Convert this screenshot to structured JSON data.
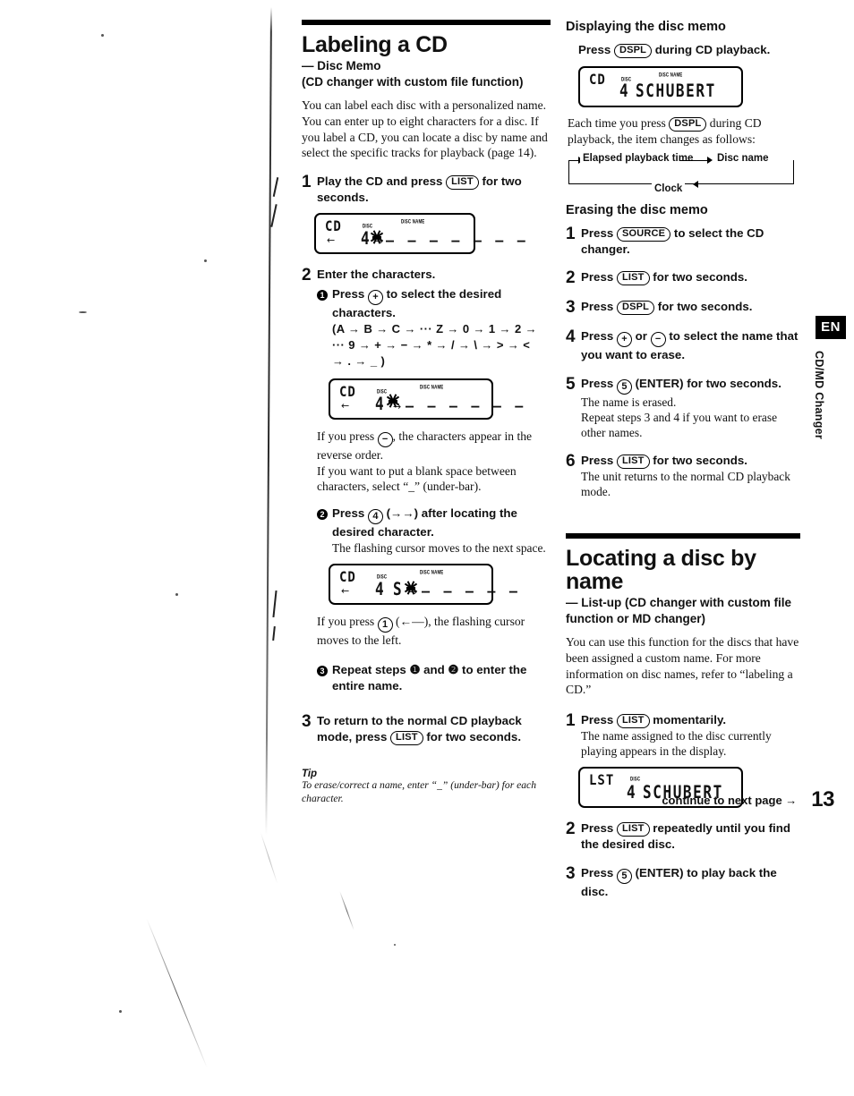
{
  "page": {
    "number": "13",
    "continue_note": "continue to next page →",
    "side_tab_language": "EN",
    "side_tab_section": "CD/MD Changer"
  },
  "left_column": {
    "title": "Labeling a CD",
    "subtitle_line1": "— Disc Memo",
    "subtitle_line2": "(CD changer with custom file function)",
    "intro": "You can label each disc with a personalized name. You can enter up to eight characters for a disc. If you label a CD, you can locate a disc by name and select the specific tracks for playback (page 14).",
    "steps": [
      {
        "num": "1",
        "title_pre": "Play the CD and press ",
        "key": "LIST",
        "title_post": " for two seconds."
      },
      {
        "num": "2",
        "title": "Enter the characters."
      },
      {
        "num": "3",
        "title_pre": "To return to the normal CD playback mode, press ",
        "key": "LIST",
        "title_post": " for two seconds."
      }
    ],
    "substeps": [
      {
        "bullet": "1",
        "title_pre": "Press ",
        "key": "+",
        "title_post": " to select the desired characters.",
        "charseq_line1": "(A → B → C → ··· Z → 0 → 1 → 2 →",
        "charseq_line2": "··· 9 → + → − → * → / → \\ → > → <",
        "charseq_line3": "→ . → _ )",
        "note_line1_pre": "If you press ",
        "note_key": "−",
        "note_line1_post": ", the characters appear in the reverse order.",
        "note_line2": "If you want to put a blank space between characters, select “_” (under-bar)."
      },
      {
        "bullet": "2",
        "title_pre": "Press ",
        "key": "4",
        "title_mid": " (→→) after locating the desired character.",
        "note": "The flashing cursor moves to the next space.",
        "note2_pre": "If you press ",
        "note2_key": "1",
        "note2_post": " (←—), the flashing cursor moves to the left."
      },
      {
        "bullet": "3",
        "title": "Repeat steps ❶ and ❷ to enter the entire name."
      }
    ],
    "displays": [
      {
        "mode": "CD",
        "label_disc": "DISC",
        "label_name": "DISC NAME",
        "disc_number": "4",
        "text": "",
        "dashes": "— — — — — — —",
        "arrow_left": "←",
        "arrow_right": "→",
        "cursor": true
      },
      {
        "mode": "CD",
        "label_disc": "DISC",
        "label_name": "DISC NAME",
        "disc_number": "4",
        "text": "",
        "dashes": "— — — — — —",
        "arrow_left": "←",
        "arrow_right": "→",
        "cursor": true
      },
      {
        "mode": "CD",
        "label_disc": "DISC",
        "label_name": "DISC NAME",
        "disc_number": "4",
        "text": "S",
        "dashes": "— — — — —",
        "arrow_left": "←",
        "arrow_right": "→",
        "cursor": true
      }
    ],
    "tip_heading": "Tip",
    "tip_text": "To erase/correct a name, enter “_” (under-bar) for each character."
  },
  "right_column": {
    "section1": {
      "heading": "Displaying the disc memo",
      "instruction_pre": "Press ",
      "instruction_key": "DSPL",
      "instruction_post": " during CD playback.",
      "display": {
        "mode": "CD",
        "label_disc": "DISC",
        "label_name": "DISC NAME",
        "disc_number": "4",
        "text": "SCHUBERT"
      },
      "body_pre": "Each time you press ",
      "body_key": "DSPL",
      "body_post": " during CD playback, the item changes as follows:",
      "cycle": [
        "Elapsed playback time",
        "Disc name",
        "Clock"
      ]
    },
    "section2": {
      "heading": "Erasing the disc memo",
      "steps": [
        {
          "num": "1",
          "pre": "Press ",
          "key": "SOURCE",
          "post": " to select the CD changer.",
          "note": ""
        },
        {
          "num": "2",
          "pre": "Press ",
          "key": "LIST",
          "post": " for two seconds.",
          "note": ""
        },
        {
          "num": "3",
          "pre": "Press ",
          "key": "DSPL",
          "post": " for two seconds.",
          "note": ""
        },
        {
          "num": "4",
          "pre": "Press ",
          "key": "+",
          "key2": "−",
          "mid": " or ",
          "post": " to select the name that you want to erase.",
          "note": ""
        },
        {
          "num": "5",
          "pre": "Press ",
          "key": "5",
          "post": " (ENTER) for two seconds.",
          "note": "The name is erased.\nRepeat steps 3 and 4 if you want to erase other names."
        },
        {
          "num": "6",
          "pre": "Press ",
          "key": "LIST",
          "post": " for two seconds.",
          "note": "The unit returns to the normal CD playback mode."
        }
      ]
    },
    "section3": {
      "title": "Locating a disc by name",
      "subtitle_line1": "— List-up (CD changer with custom file",
      "subtitle_line2": "function or MD changer)",
      "intro": "You can use this function for the discs that have been assigned a custom name. For more information on disc names, refer to “labeling a CD.”",
      "steps": [
        {
          "num": "1",
          "pre": "Press ",
          "key": "LIST",
          "post": " momentarily.",
          "note": "The name assigned to the disc currently playing appears in the display."
        },
        {
          "num": "2",
          "pre": "Press ",
          "key": "LIST",
          "post": " repeatedly until you find the desired disc.",
          "note": ""
        },
        {
          "num": "3",
          "pre": "Press ",
          "key": "5",
          "post": " (ENTER) to play back the disc.",
          "note": ""
        }
      ],
      "display": {
        "mode": "LST",
        "label_disc": "DISC",
        "disc_number": "4",
        "text": "SCHUBERT"
      }
    }
  }
}
